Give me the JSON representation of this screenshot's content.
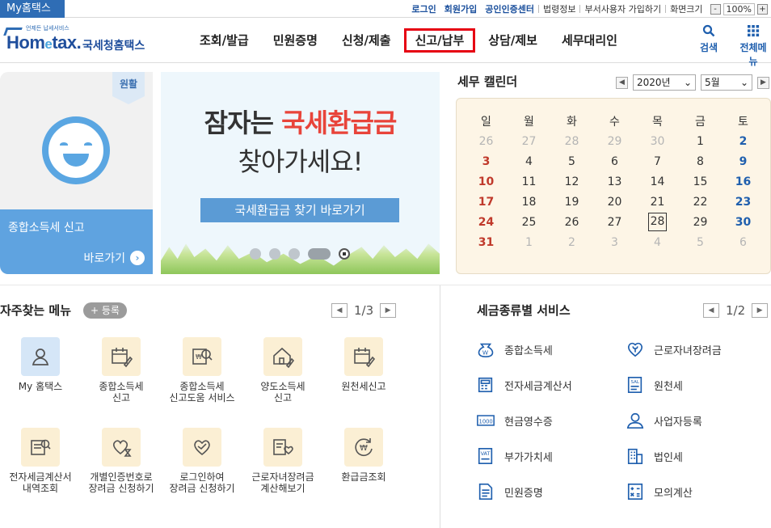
{
  "topbar": {
    "my_tab": "My홈택스",
    "links": [
      "로그인",
      "회원가입",
      "공인인증센터",
      "법령정보",
      "부서사용자 가입하기",
      "화면크기"
    ],
    "zoom_minus": "-",
    "zoom_value": "100%",
    "zoom_plus": "+"
  },
  "logo": {
    "tagline": "언제든 납세서비스",
    "en_pre": "Hom",
    "en_e": "e",
    "en_post": "tax.",
    "ko": "국세청홈택스"
  },
  "nav": {
    "items": [
      "조회/발급",
      "민원증명",
      "신청/제출",
      "신고/납부",
      "상담/제보",
      "세무대리인"
    ],
    "active_index": 3,
    "search_label": "검색",
    "menu_label": "전체메뉴"
  },
  "promo": {
    "badge": "원활",
    "title": "종합소득세 신고",
    "link": "바로가기"
  },
  "banner": {
    "line1_prefix": "잠자는 ",
    "line1_highlight": "국세환급금",
    "line2": "찾아가세요!",
    "button": "국세환급금 찾기 바로가기"
  },
  "calendar": {
    "title": "세무 캘린더",
    "year": "2020년",
    "month": "5월",
    "weekdays": [
      "일",
      "월",
      "화",
      "수",
      "목",
      "금",
      "토"
    ],
    "weeks": [
      [
        "26",
        "27",
        "28",
        "29",
        "30",
        "1",
        "2"
      ],
      [
        "3",
        "4",
        "5",
        "6",
        "7",
        "8",
        "9"
      ],
      [
        "10",
        "11",
        "12",
        "13",
        "14",
        "15",
        "16"
      ],
      [
        "17",
        "18",
        "19",
        "20",
        "21",
        "22",
        "23"
      ],
      [
        "24",
        "25",
        "26",
        "27",
        "28",
        "29",
        "30"
      ],
      [
        "31",
        "1",
        "2",
        "3",
        "4",
        "5",
        "6"
      ]
    ],
    "today": "28"
  },
  "favorites": {
    "title": "자주찾는 메뉴",
    "add_label": "+ 등록",
    "page": "1/3",
    "items": [
      {
        "line1": "My 홈택스",
        "line2": "",
        "icon": "person-icon"
      },
      {
        "line1": "종합소득세",
        "line2": "신고",
        "icon": "calendar-pen-icon"
      },
      {
        "line1": "종합소득세",
        "line2": "신고도움 서비스",
        "icon": "document-search-icon"
      },
      {
        "line1": "양도소득세",
        "line2": "신고",
        "icon": "house-pen-icon"
      },
      {
        "line1": "원천세신고",
        "line2": "",
        "icon": "calendar-pen-icon"
      },
      {
        "line1": "전자세금계산서",
        "line2": "내역조회",
        "icon": "invoice-search-icon"
      },
      {
        "line1": "개별인증번호로",
        "line2": "장려금 신청하기",
        "icon": "heart-hourglass-icon"
      },
      {
        "line1": "로그인하여",
        "line2": "장려금 신청하기",
        "icon": "heart-check-icon"
      },
      {
        "line1": "근로자녀장려금",
        "line2": "계산해보기",
        "icon": "document-heart-icon"
      },
      {
        "line1": "환급금조회",
        "line2": "",
        "icon": "won-refresh-icon"
      }
    ]
  },
  "services": {
    "title": "세금종류별 서비스",
    "page": "1/2",
    "items": [
      {
        "label": "종합소득세",
        "icon": "money-bag-icon"
      },
      {
        "label": "근로자녀장려금",
        "icon": "heart-sprout-icon"
      },
      {
        "label": "전자세금계산서",
        "icon": "calculator-doc-icon"
      },
      {
        "label": "원천세",
        "icon": "sal-doc-icon"
      },
      {
        "label": "현금영수증",
        "icon": "receipt-1000-icon"
      },
      {
        "label": "사업자등록",
        "icon": "user-icon"
      },
      {
        "label": "부가가치세",
        "icon": "vat-doc-icon"
      },
      {
        "label": "법인세",
        "icon": "building-icon"
      },
      {
        "label": "민원증명",
        "icon": "document-icon"
      },
      {
        "label": "모의계산",
        "icon": "calculator-icon"
      }
    ]
  },
  "colors": {
    "brand": "#1f4e9c",
    "accent_blue": "#5aa6e2",
    "active_border": "#e60012",
    "sunday": "#c0392b",
    "saturday": "#1f5fae"
  }
}
